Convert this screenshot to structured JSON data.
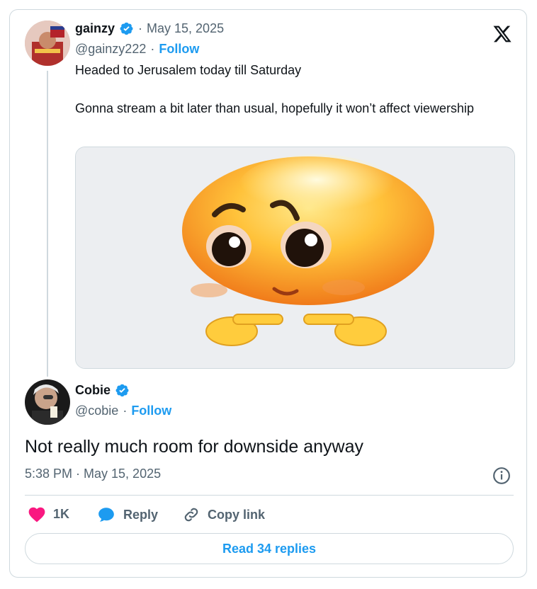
{
  "quoted_tweet": {
    "author_name": "gainzy",
    "separator": "·",
    "date": "May 15, 2025",
    "handle": "@gainzy222",
    "follow_label": "Follow",
    "text": "Headed to Jerusalem today till Saturday\n\nGonna stream a bit later than usual, hopefully it won’t affect viewership",
    "media": {
      "description_icon": "shy-emoji-pointing-fingers"
    }
  },
  "reply_tweet": {
    "author_name": "Cobie",
    "handle": "@cobie",
    "separator": "·",
    "follow_label": "Follow",
    "text": "Not really much room for downside anyway",
    "timestamp": "5:38 PM · May 15, 2025"
  },
  "actions": {
    "like_count": "1K",
    "reply_label": "Reply",
    "copy_link_label": "Copy link"
  },
  "read_replies_label": "Read 34 replies",
  "colors": {
    "accent": "#1d9bf0",
    "like": "#f91880",
    "verified": "#1d9bf0",
    "muted": "#536471",
    "border": "#cfd9de"
  }
}
